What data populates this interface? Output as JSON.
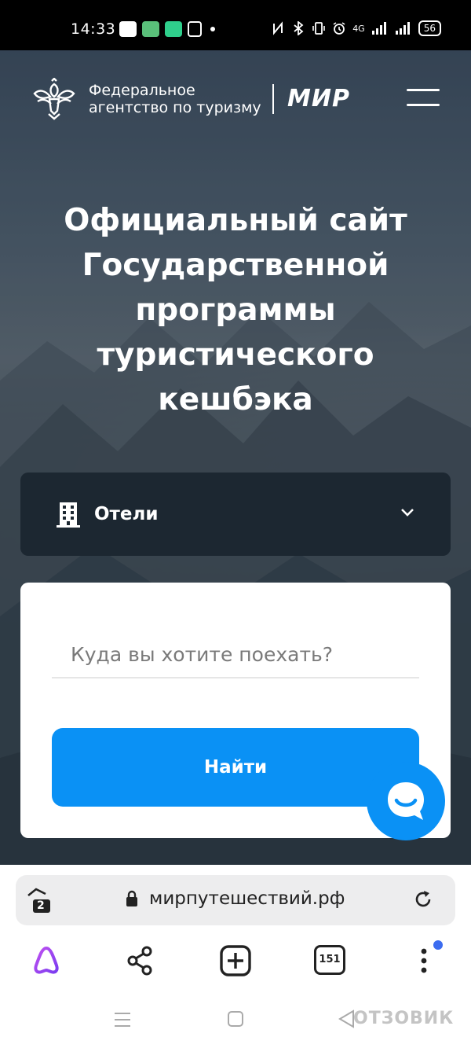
{
  "status_bar": {
    "time": "14:33",
    "battery": "56",
    "network": "4G",
    "app_icon_colors": [
      "#ffffff",
      "#5ac07a",
      "#2fcf8c",
      "#ffffff"
    ]
  },
  "header": {
    "agency_name_line1": "Федеральное",
    "agency_name_line2": "агентство по туризму",
    "partner_logo": "МИР",
    "icons": [
      "eagle-emblem-icon",
      "hamburger-menu-icon"
    ]
  },
  "hero": {
    "title": "Официальный сайт Государственной программы туристического кешбэка"
  },
  "category_select": {
    "icon": "hotel-building-icon",
    "selected": "Отели"
  },
  "search_form": {
    "destination_placeholder": "Куда вы хотите поехать?",
    "destination_value": "",
    "submit_label": "Найти"
  },
  "chat_widget": {
    "icon": "chat-smile-icon"
  },
  "browser": {
    "url": "мирпутешествий.рф",
    "protected_tabs_count": "2",
    "tabs_count": "151",
    "accent_color": "#0a91f5",
    "notification_dot_color": "#3c6cf0",
    "toolbar_icons": [
      "alice-icon",
      "share-icon",
      "new-tab-icon",
      "tabs-icon",
      "more-icon"
    ]
  },
  "navigation_bar": {
    "watermark": "ОТЗОВИК"
  }
}
